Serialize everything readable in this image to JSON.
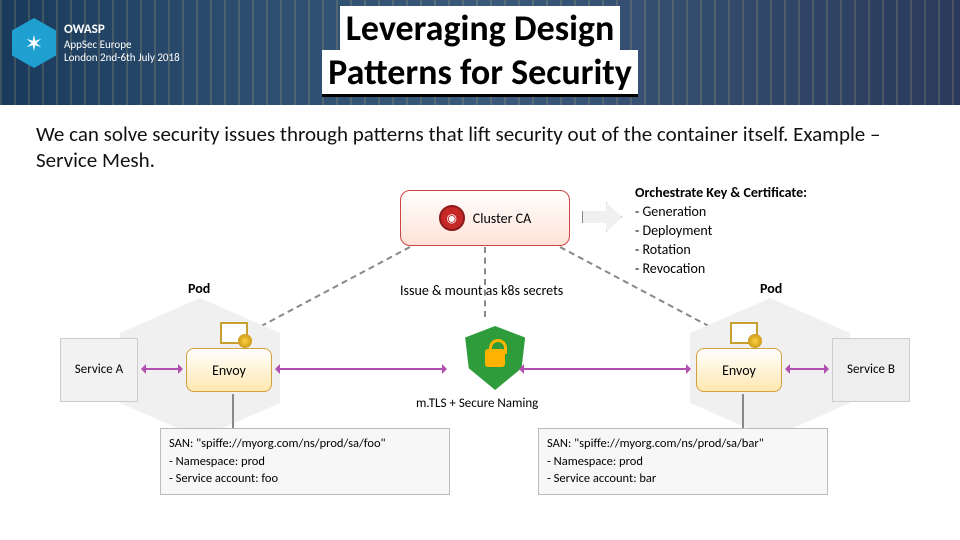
{
  "header": {
    "brand_line1": "OWASP",
    "brand_line2": "AppSec Europe",
    "brand_line3": "London 2nd-6th July 2018",
    "title_line1": "Leveraging Design",
    "title_line2": "Patterns for Security"
  },
  "body_text": "We can solve security issues through patterns that lift security out of the container itself. Example – Service Mesh.",
  "diagram": {
    "cluster_ca": "Cluster CA",
    "orchestrate_header": "Orchestrate Key & Certificate:",
    "orchestrate_items": [
      "- Generation",
      "- Deployment",
      "- Rotation",
      "- Revocation"
    ],
    "issue_label": "Issue & mount as k8s secrets",
    "pod_label": "Pod",
    "service_a": "Service A",
    "service_b": "Service B",
    "envoy": "Envoy",
    "mtls_label": "m.TLS + Secure Naming",
    "san_a": {
      "line1": "SAN: \"spiffe://myorg.com/ns/prod/sa/foo\"",
      "line2": "- Namespace: prod",
      "line3": "- Service account: foo"
    },
    "san_b": {
      "line1": "SAN: \"spiffe://myorg.com/ns/prod/sa/bar\"",
      "line2": "- Namespace: prod",
      "line3": "- Service account: bar"
    }
  }
}
